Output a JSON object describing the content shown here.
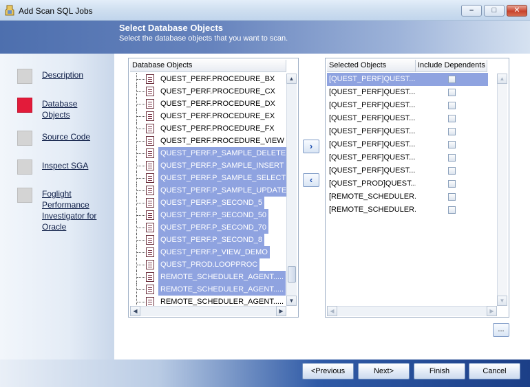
{
  "window": {
    "title": "Add Scan SQL Jobs"
  },
  "header": {
    "title": "Select Database Objects",
    "subtitle": "Select the database objects that you want to scan."
  },
  "steps": [
    {
      "label": "Description",
      "active": false
    },
    {
      "label": "Database Objects",
      "active": true
    },
    {
      "label": "Source Code",
      "active": false
    },
    {
      "label": "Inspect SGA",
      "active": false
    },
    {
      "label": "Foglight Performance Investigator for Oracle",
      "active": false
    }
  ],
  "available_list": {
    "header": "Database Objects",
    "items": [
      {
        "text": "QUEST_PERF.PROCEDURE_BX",
        "selected": false
      },
      {
        "text": "QUEST_PERF.PROCEDURE_CX",
        "selected": false
      },
      {
        "text": "QUEST_PERF.PROCEDURE_DX",
        "selected": false
      },
      {
        "text": "QUEST_PERF.PROCEDURE_EX",
        "selected": false
      },
      {
        "text": "QUEST_PERF.PROCEDURE_FX",
        "selected": false
      },
      {
        "text": "QUEST_PERF.PROCEDURE_VIEW",
        "selected": false
      },
      {
        "text": "QUEST_PERF.P_SAMPLE_DELETE",
        "selected": true
      },
      {
        "text": "QUEST_PERF.P_SAMPLE_INSERT",
        "selected": true
      },
      {
        "text": "QUEST_PERF.P_SAMPLE_SELECT",
        "selected": true
      },
      {
        "text": "QUEST_PERF.P_SAMPLE_UPDATE",
        "selected": true
      },
      {
        "text": "QUEST_PERF.P_SECOND_5",
        "selected": true
      },
      {
        "text": "QUEST_PERF.P_SECOND_50",
        "selected": true
      },
      {
        "text": "QUEST_PERF.P_SECOND_70",
        "selected": true
      },
      {
        "text": "QUEST_PERF.P_SECOND_8",
        "selected": true
      },
      {
        "text": "QUEST_PERF.P_VIEW_DEMO",
        "selected": true
      },
      {
        "text": "QUEST_PROD.LOOPPROC",
        "selected": true
      },
      {
        "text": "REMOTE_SCHEDULER_AGENT.....",
        "selected": true
      },
      {
        "text": "REMOTE_SCHEDULER_AGENT.....",
        "selected": true
      },
      {
        "text": "REMOTE_SCHEDULER_AGENT.....",
        "selected": false
      }
    ]
  },
  "selected_list": {
    "header_name": "Selected Objects",
    "header_dependents": "Include Dependents",
    "items": [
      {
        "text": "[QUEST_PERF]QUEST...",
        "active": true
      },
      {
        "text": "[QUEST_PERF]QUEST...",
        "active": false
      },
      {
        "text": "[QUEST_PERF]QUEST...",
        "active": false
      },
      {
        "text": "[QUEST_PERF]QUEST...",
        "active": false
      },
      {
        "text": "[QUEST_PERF]QUEST...",
        "active": false
      },
      {
        "text": "[QUEST_PERF]QUEST...",
        "active": false
      },
      {
        "text": "[QUEST_PERF]QUEST...",
        "active": false
      },
      {
        "text": "[QUEST_PERF]QUEST...",
        "active": false
      },
      {
        "text": "[QUEST_PROD]QUEST...",
        "active": false
      },
      {
        "text": "[REMOTE_SCHEDULER...",
        "active": false
      },
      {
        "text": "[REMOTE_SCHEDULER...",
        "active": false
      }
    ]
  },
  "buttons": {
    "move_right": "›",
    "move_left": "‹",
    "ellipsis": "...",
    "previous": "<Previous",
    "next": "Next>",
    "finish": "Finish",
    "cancel": "Cancel"
  },
  "colors": {
    "active_step": "#e31b3a",
    "selection": "#8fa3e0",
    "banner": "#4d6fae"
  }
}
